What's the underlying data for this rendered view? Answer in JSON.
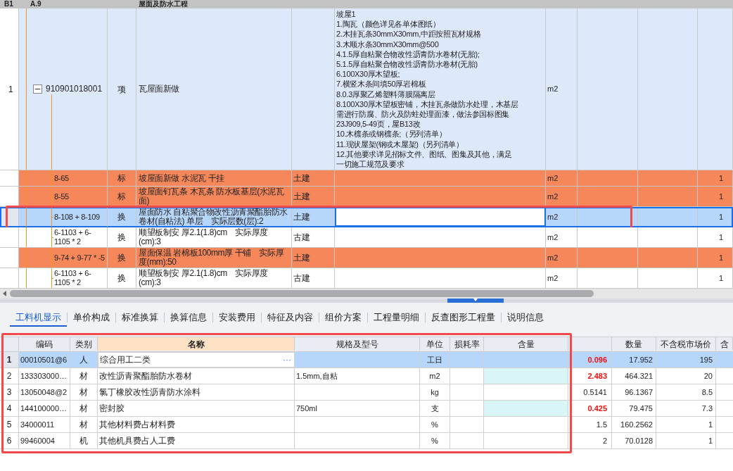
{
  "upper_table": {
    "group_row": {
      "number": "B1",
      "code": "A.9",
      "name": "屋面及防水工程"
    },
    "rows": [
      {
        "kind": "bill",
        "number": "1",
        "code": "910901018001",
        "expanded": true,
        "type": "项",
        "name": "瓦屋面新做",
        "features": [
          "坡屋1",
          "1.陶瓦（颜色详见各单体图纸）",
          "2.木挂瓦条30mmX30mm,中距按照瓦材规格",
          "3.木顺水条30mmX30mm@500",
          "4.1.5厚自粘聚合物改性沥青防水卷材(无胎);",
          "5.1.5厚自粘聚合物改性沥青防水卷材(无胎)",
          "6.100X30厚木望板;",
          "7.横竖木条间填50厚岩棉板",
          "8.0.3厚聚乙烯塑料薄膜隔离层",
          "8.100X30厚木望板密铺，木挂瓦条做防水处理，木基层",
          "需进行防腐、防火及防蛀处理面漆，做法参国标图集",
          "23J909,5-49页，屋B13改",
          "10.木檩条或钢檩条;（另列清单）",
          "11.现状屋架(钢或木屋架)（另列清单）",
          "12.其他要求详见招标文件、图纸、图集及其他，满足",
          "一切施工规范及要求"
        ],
        "unit": "m2",
        "flagged": false,
        "selected": false
      },
      {
        "kind": "quota",
        "code": "8-65",
        "type": "标",
        "name": "坡屋面新做 水泥瓦 干挂",
        "category": "土建",
        "unit": "m2",
        "amount": "1",
        "flagged": true,
        "selected": false
      },
      {
        "kind": "quota",
        "code": "8-55",
        "type": "标",
        "name": "坡屋面钉瓦条 木瓦条 防水板基层(水泥瓦面)",
        "category": "土建",
        "unit": "m2",
        "amount": "1",
        "flagged": true,
        "selected": false
      },
      {
        "kind": "quota",
        "code": "8-108 + 8-109",
        "type": "换",
        "name": "屋面防水 自粘聚合物改性沥青聚酯胎防水卷材(自粘法) 单层　实际层数(层):2",
        "category": "土建",
        "unit": "m2",
        "amount": "1",
        "flagged": false,
        "selected": true
      },
      {
        "kind": "quota",
        "code": "6-1103 + 6-1105 * 2",
        "type": "换",
        "name": "顺望板制安 厚2.1(1.8)cm　实际厚度(cm):3",
        "category": "古建",
        "unit": "m2",
        "amount": "1",
        "flagged": false,
        "selected": false
      },
      {
        "kind": "quota",
        "code": "9-74 + 9-77 * -5",
        "type": "换",
        "name": "屋面保温 岩棉板100mm厚 干铺　实际厚度(mm):50",
        "category": "土建",
        "unit": "m2",
        "amount": "1",
        "flagged": true,
        "selected": false
      },
      {
        "kind": "quota",
        "code": "6-1103 + 6-1105 * 2",
        "type": "换",
        "name": "顺望板制安 厚2.1(1.8)cm　实际厚度(cm):3",
        "category": "古建",
        "unit": "m2",
        "amount": "1",
        "flagged": false,
        "selected": false
      }
    ]
  },
  "tabs": [
    {
      "label": "工料机显示",
      "selected": true
    },
    {
      "label": "单价构成",
      "selected": false
    },
    {
      "label": "标准换算",
      "selected": false
    },
    {
      "label": "换算信息",
      "selected": false
    },
    {
      "label": "安装费用",
      "selected": false
    },
    {
      "label": "特征及内容",
      "selected": false
    },
    {
      "label": "组价方案",
      "selected": false
    },
    {
      "label": "工程量明细",
      "selected": false
    },
    {
      "label": "反查图形工程量",
      "selected": false
    },
    {
      "label": "说明信息",
      "selected": false
    }
  ],
  "lower_table": {
    "columns": [
      {
        "label": "编码",
        "selected": false
      },
      {
        "label": "类别",
        "selected": false
      },
      {
        "label": "名称",
        "selected": true
      },
      {
        "label": "规格及型号",
        "selected": false
      },
      {
        "label": "单位",
        "selected": false
      },
      {
        "label": "损耗率",
        "selected": false
      },
      {
        "label": "含量",
        "selected": false
      },
      {
        "selected": false
      },
      {
        "label": "数量",
        "selected": false
      },
      {
        "label": "不含税市场价",
        "selected": false
      },
      {
        "label": "含",
        "selected": false
      }
    ],
    "rows": [
      {
        "number": "1",
        "code": "00010501@6",
        "category": "人",
        "name": "综合用工二类",
        "editor_button": "···",
        "unit": "工日",
        "value": "0.096",
        "value_changed": true,
        "quantity": "17.952",
        "price": "195",
        "ratio_edited": false,
        "selected": true
      },
      {
        "number": "2",
        "code": "133303000…",
        "category": "材",
        "name": "改性沥青聚酯胎防水卷材",
        "spec": "1.5mm,自粘",
        "unit": "m2",
        "value": "2.483",
        "value_changed": true,
        "quantity": "464.321",
        "price": "20",
        "ratio_edited": true,
        "selected": false
      },
      {
        "number": "3",
        "code": "13050048@2",
        "category": "材",
        "name": "氯丁橡胶改性沥青防水涂料",
        "unit": "kg",
        "value": "0.5141",
        "value_changed": false,
        "quantity": "96.1367",
        "price": "8.5",
        "ratio_edited": false,
        "selected": false
      },
      {
        "number": "4",
        "code": "144100000…",
        "category": "材",
        "name": "密封胶",
        "spec": "750ml",
        "unit": "支",
        "value": "0.425",
        "value_changed": true,
        "quantity": "79.475",
        "price": "7.3",
        "ratio_edited": true,
        "selected": false
      },
      {
        "number": "5",
        "code": "34000011",
        "category": "材",
        "name": "其他材料费占材料费",
        "unit": "%",
        "value": "1.5",
        "value_changed": false,
        "quantity": "160.2562",
        "price": "1",
        "ratio_edited": false,
        "selected": false
      },
      {
        "number": "6",
        "code": "99460004",
        "category": "机",
        "name": "其他机具费占人工费",
        "unit": "%",
        "value": "2",
        "value_changed": false,
        "quantity": "70.0128",
        "price": "1",
        "ratio_edited": false,
        "selected": false
      }
    ]
  }
}
